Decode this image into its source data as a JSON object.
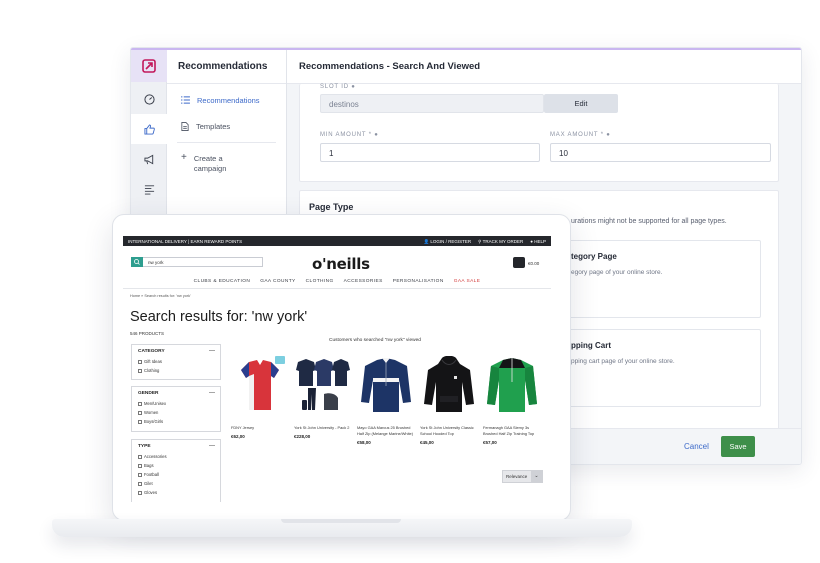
{
  "admin": {
    "subnav_title": "Recommendations",
    "subnav_items": [
      {
        "label": "Recommendations",
        "icon": "list-icon"
      },
      {
        "label": "Templates",
        "icon": "document-icon"
      },
      {
        "label": "Create a campaign",
        "icon": "plus-icon"
      }
    ],
    "main_title": "Recommendations - Search And Viewed",
    "slot_id_label": "SLOT ID",
    "slot_value": "destinos",
    "edit_label": "Edit",
    "min_label": "MIN AMOUNT *",
    "min_value": "1",
    "max_label": "MAX AMOUNT *",
    "max_value": "10",
    "page_type_title": "Page Type",
    "page_type_note": "urations might not be supported for all page types.",
    "category_title": "tegory Page",
    "category_desc": "egory page of your online store.",
    "cart_title": "pping Cart",
    "cart_desc": "pping cart page of your online store.",
    "cancel_label": "Cancel",
    "save_label": "Save",
    "colors": {
      "accent": "#3d6ac9",
      "save": "#3e8f4a",
      "brand": "#c9b6f0"
    }
  },
  "shop": {
    "topbar_left": "INTERNATIONAL DELIVERY | EARN REWARD POINTS",
    "topbar_links": [
      "LOGIN / REGISTER",
      "TRACK MY ORDER",
      "HELP"
    ],
    "search_value": "nw york",
    "brand": "o'neills",
    "cart_total": "€0.00",
    "categories": [
      "CLUBS & EDUCATION",
      "GAA COUNTY",
      "CLOTHING",
      "ACCESSORIES",
      "PERSONALISATION",
      "GAA SALE"
    ],
    "breadcrumb": "Home » Search results for: 'nw york'",
    "results_title": "Search results for: 'nw york'",
    "products_count": "546 PRODUCTS",
    "filters": [
      {
        "title": "CATEGORY",
        "options": [
          "Gift Ideas",
          "Clothing"
        ]
      },
      {
        "title": "GENDER",
        "options": [
          "Men/Unisex",
          "Women",
          "Boys/Girls"
        ]
      },
      {
        "title": "TYPE",
        "options": [
          "Accessories",
          "Bags",
          "Football",
          "Gilet",
          "Gloves"
        ]
      }
    ],
    "shelf_title": "Customers who searched \"nw york\" viewed",
    "products": [
      {
        "name": "FDNY Jersey",
        "price": "€62,00"
      },
      {
        "name": "York St John University - Pack 2",
        "price": "€228,00"
      },
      {
        "name": "Mayo GAA Marcus 25 Brushed Half Zip (Melange Marine/White)",
        "price": "€58,00"
      },
      {
        "name": "York St John University Classic School Hooded Top",
        "price": "€45,00"
      },
      {
        "name": "Fermanagh GAA Slemy 3s Brushed Half Zip Training Top",
        "price": "€57,00"
      }
    ],
    "sort_label": "Relevance"
  }
}
